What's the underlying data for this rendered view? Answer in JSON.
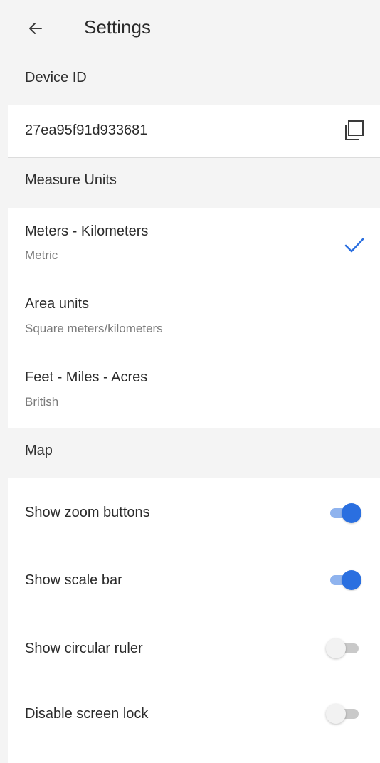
{
  "header": {
    "title": "Settings",
    "back_icon": "arrow-left-icon"
  },
  "device_id_section": {
    "header": "Device ID",
    "value": "27ea95f91d933681",
    "copy_icon": "copy-icon"
  },
  "measure_units_section": {
    "header": "Measure Units",
    "items": [
      {
        "label": "Meters - Kilometers",
        "subtitle": "Metric",
        "selected": true
      },
      {
        "label": "Area units",
        "subtitle": "Square meters/kilometers",
        "selected": false
      },
      {
        "label": "Feet - Miles - Acres",
        "subtitle": "British",
        "selected": false
      }
    ],
    "check_icon": "checkmark-icon",
    "check_color": "#2a6fe0"
  },
  "map_section": {
    "header": "Map",
    "toggles": [
      {
        "label": "Show zoom buttons",
        "on": true
      },
      {
        "label": "Show scale bar",
        "on": true
      },
      {
        "label": "Show circular ruler",
        "on": false
      },
      {
        "label": "Disable screen lock",
        "on": false
      }
    ]
  },
  "colors": {
    "accent": "#2a6fe0",
    "header_bg": "#f4f4f4"
  }
}
